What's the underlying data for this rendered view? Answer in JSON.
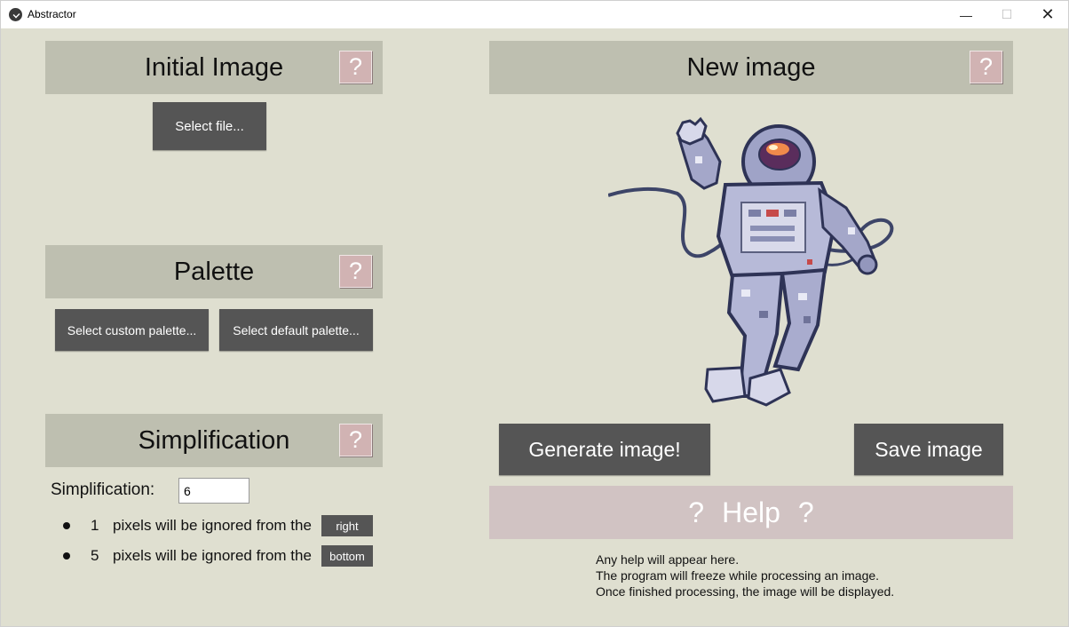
{
  "window": {
    "title": "Abstractor",
    "minimize_glyph": "—",
    "maximize_glyph": "☐",
    "close_glyph": "✕"
  },
  "initial_image": {
    "title": "Initial Image",
    "help_glyph": "?",
    "select_file_label": "Select file..."
  },
  "palette": {
    "title": "Palette",
    "help_glyph": "?",
    "custom_label": "Select custom palette...",
    "default_label": "Select default palette..."
  },
  "simplification": {
    "title": "Simplification",
    "help_glyph": "?",
    "field_label": "Simplification:",
    "value": "6",
    "rows": [
      {
        "count": "1",
        "text": "pixels will be ignored from the",
        "side": "right"
      },
      {
        "count": "5",
        "text": "pixels will be ignored from the",
        "side": "bottom"
      }
    ]
  },
  "new_image": {
    "title": "New image",
    "help_glyph": "?",
    "image_subject": "astronaut-pixel-art"
  },
  "actions": {
    "generate_label": "Generate image!",
    "save_label": "Save image"
  },
  "help": {
    "title": "Help",
    "left_glyph": "?",
    "right_glyph": "?",
    "lines": [
      "Any help will appear here.",
      "The program will freeze while processing an image.",
      "Once finished processing, the image will be displayed."
    ]
  },
  "colors": {
    "background": "#dfdfd0",
    "header": "#bebfb0",
    "help_button": "#d1b3b3",
    "dark_button": "#555555",
    "help_panel": "#d1c3c3"
  }
}
